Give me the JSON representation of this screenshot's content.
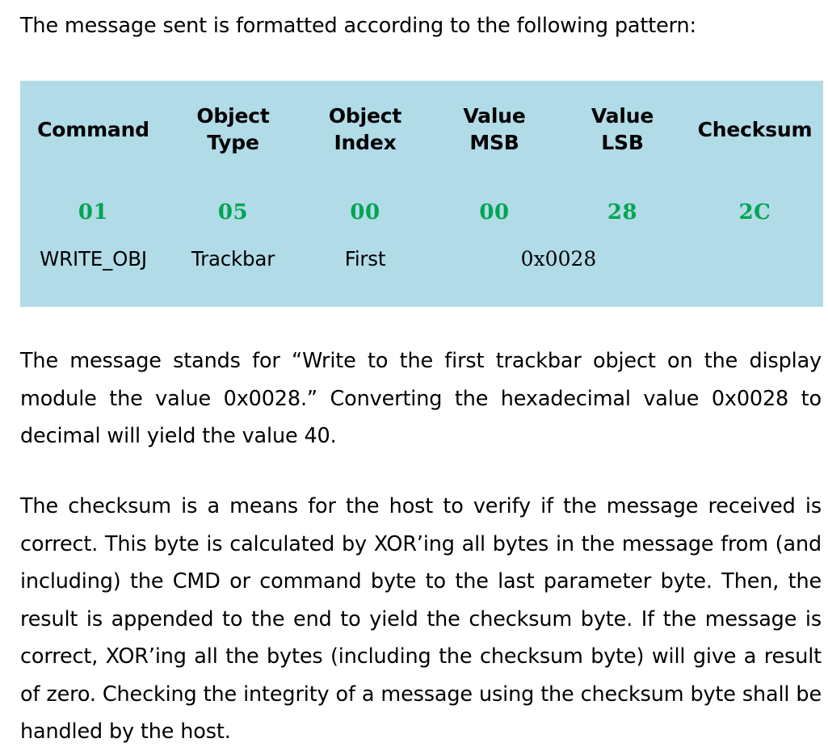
{
  "document": {
    "intro_line": "The message sent is formatted according to the following pattern:",
    "table": {
      "background_color": "#b2dbe8",
      "hex_value_color": "#00a552",
      "headers": {
        "command": "Command",
        "object_type_line1": "Object",
        "object_type_line2": "Type",
        "object_index_line1": "Object",
        "object_index_line2": "Index",
        "value_msb_line1": "Value",
        "value_msb_line2": "MSB",
        "value_lsb_line1": "Value",
        "value_lsb_line2": "LSB",
        "checksum": "Checksum"
      },
      "hex_bytes": {
        "command": "01",
        "object_type": "05",
        "object_index": "00",
        "value_msb": "00",
        "value_lsb": "28",
        "checksum": "2C"
      },
      "meanings": {
        "command": "WRITE_OBJ",
        "object_type": "Trackbar",
        "object_index": "First",
        "value_combined": "0x0028",
        "checksum": ""
      }
    },
    "paragraph_1": "The message stands for “Write to the first trackbar object on the display module the value 0x0028.” Converting the hexadecimal value 0x0028 to decimal will yield the value 40.",
    "paragraph_2": "The checksum is a means for the host to verify if the message received is correct. This byte is calculated by XOR’ing all bytes in the message from (and including) the CMD or command byte to the last parameter byte. Then, the result is appended to the end to yield the checksum byte. If the message is correct, XOR’ing all the bytes (including the checksum byte) will give a result of zero. Checking the integrity of a message using the checksum byte shall be handled by the host."
  }
}
